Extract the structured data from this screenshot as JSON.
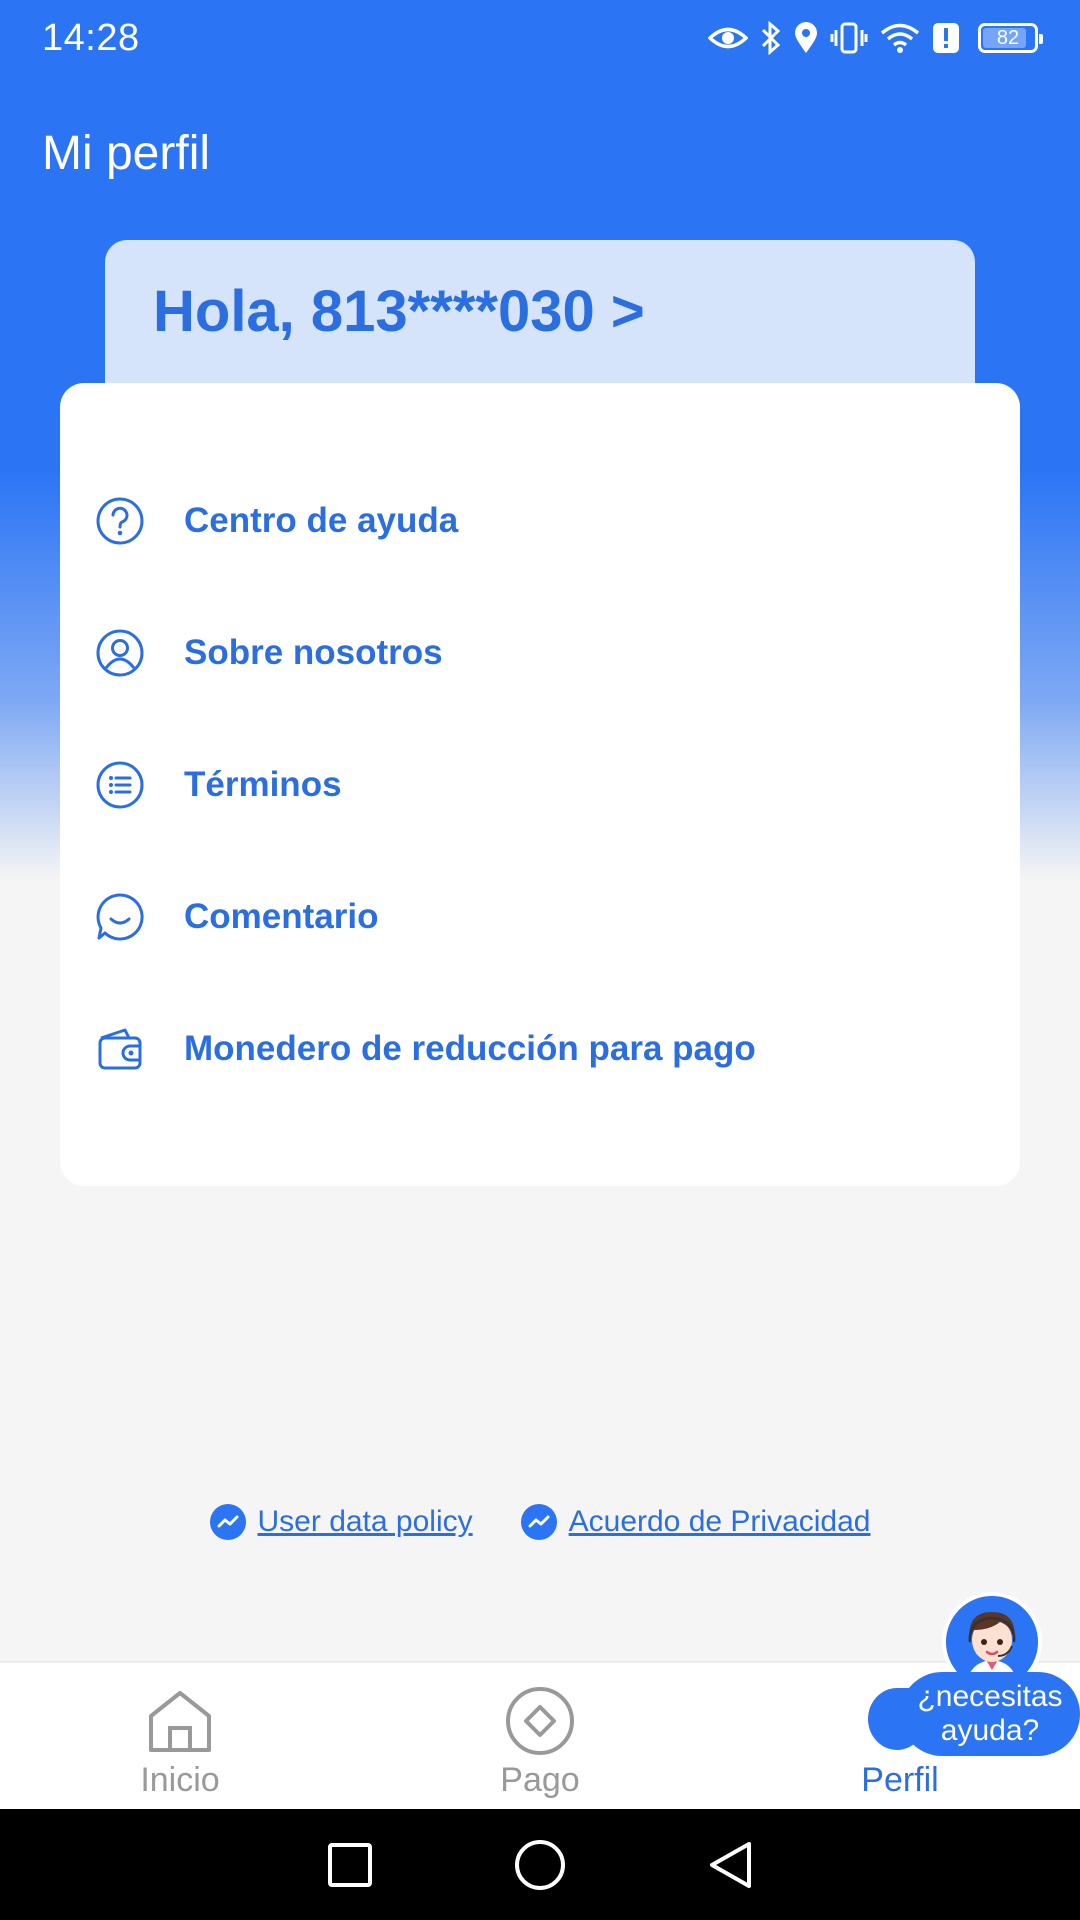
{
  "status_bar": {
    "time": "14:28",
    "battery": "82",
    "icons": [
      "eye-icon",
      "bluetooth-icon",
      "location-icon",
      "vibrate-icon",
      "wifi-icon",
      "alert-icon",
      "battery-icon"
    ]
  },
  "header": {
    "title": "Mi perfil",
    "greeting": "Hola, 813****030 >"
  },
  "menu": {
    "items": [
      {
        "label": "Centro de ayuda",
        "icon": "help-circle-icon"
      },
      {
        "label": "Sobre nosotros",
        "icon": "user-circle-icon"
      },
      {
        "label": "Términos",
        "icon": "list-icon"
      },
      {
        "label": "Comentario",
        "icon": "chat-icon"
      },
      {
        "label": "Monedero de reducción para pago",
        "icon": "wallet-icon"
      }
    ]
  },
  "policies": {
    "user_data": "User data policy",
    "privacy": "Acuerdo de Privacidad"
  },
  "bottom_nav": {
    "items": [
      {
        "label": "Inicio",
        "icon": "home-icon"
      },
      {
        "label": "Pago",
        "icon": "payment-icon"
      },
      {
        "label": "Perfil",
        "icon": "profile-icon"
      }
    ],
    "active": "Perfil"
  },
  "help_bubble": {
    "text": "¿necesitas ayuda?"
  },
  "colors": {
    "primary": "#2b75f5",
    "text_primary": "#2b6ee0",
    "card_light": "#d5e4fb",
    "inactive": "#999999"
  }
}
